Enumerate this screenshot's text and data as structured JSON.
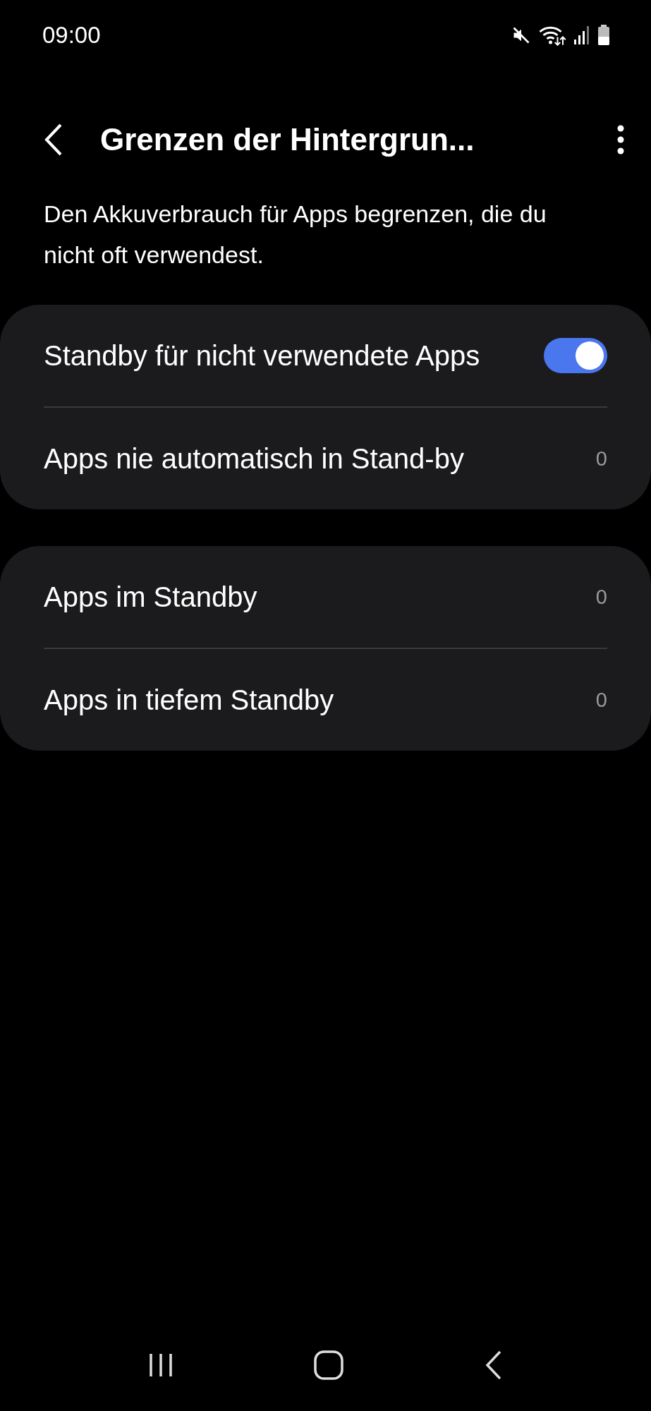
{
  "status_bar": {
    "time": "09:00"
  },
  "header": {
    "title": "Grenzen der Hintergrun..."
  },
  "description": "Den Akkuverbrauch für Apps begrenzen, die du nicht oft verwendest.",
  "groups": [
    {
      "items": [
        {
          "kind": "switch",
          "label": "Standby für nicht verwendete Apps",
          "on": true
        },
        {
          "kind": "count",
          "label": "Apps nie automatisch in Stand-by",
          "value": "0"
        }
      ]
    },
    {
      "items": [
        {
          "kind": "count",
          "label": "Apps im Standby",
          "value": "0"
        },
        {
          "kind": "count",
          "label": "Apps in tiefem Standby",
          "value": "0"
        }
      ]
    }
  ]
}
